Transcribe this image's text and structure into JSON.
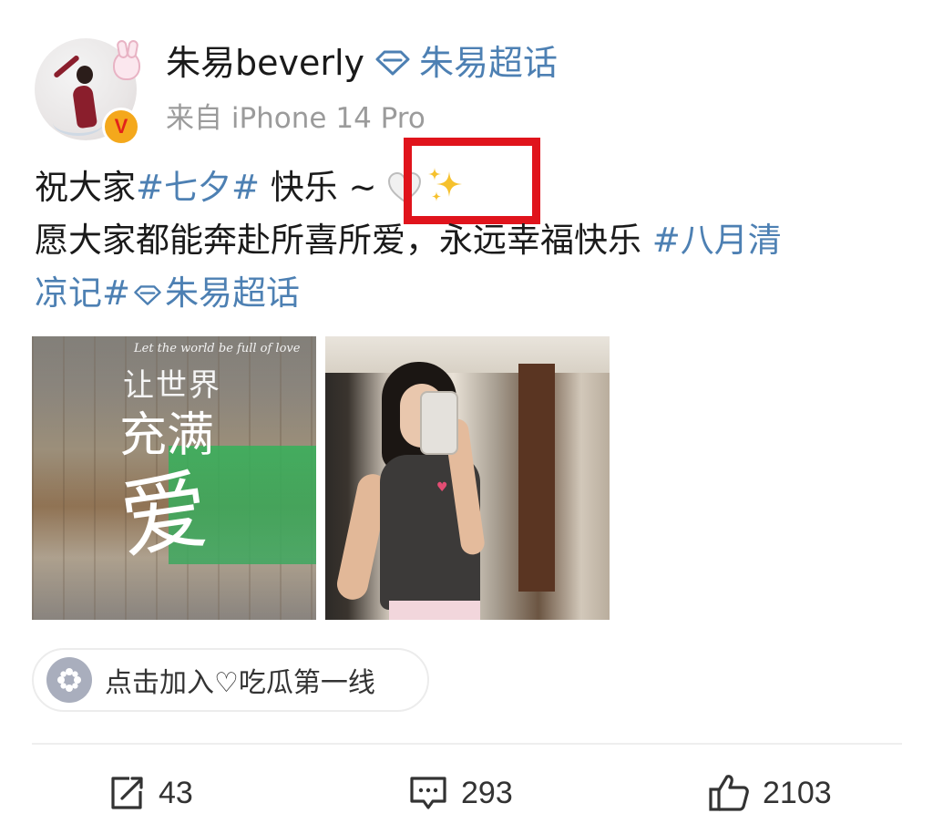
{
  "post": {
    "username": "朱易beverly",
    "super_topic": "朱易超话",
    "source": "来自 iPhone 14 Pro",
    "verified_badge": "V",
    "text": {
      "line1_prefix": "祝大家",
      "line1_tag": "#七夕#",
      "line1_suffix": " 快乐 ~ ",
      "line2_text": "愿大家都能奔赴所喜所爱，永远幸福快乐 ",
      "line2_tag": "#八月清",
      "line3_tag_end": "凉记#",
      "line3_topic": "朱易超话"
    },
    "emojis": [
      "white-heart-icon",
      "sparkles-icon"
    ],
    "images": [
      {
        "name": "calligraphy-photo",
        "script_text": "Let the world be full of love",
        "line1": "让世界",
        "line2": "充满",
        "line3": "爱"
      },
      {
        "name": "mirror-selfie-photo"
      }
    ],
    "group_pill": {
      "icon": "group-icon",
      "label": "点击加入♡吃瓜第一线"
    },
    "actions": {
      "repost_count": "43",
      "comment_count": "293",
      "like_count": "2103"
    },
    "colors": {
      "link": "#4d80b3",
      "highlight_box": "#e0141c",
      "badge": "#f4a81c",
      "muted": "#9b9b9b"
    }
  }
}
